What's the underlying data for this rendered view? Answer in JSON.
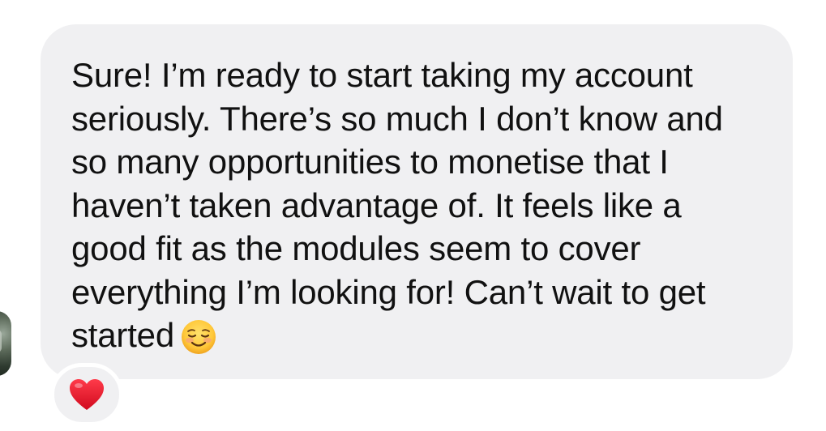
{
  "message": {
    "text": "Sure! I’m ready to start taking my account\nseriously. There’s so much I don’t know and\nso many opportunities to monetise that I\nhaven’t taken advantage of. It feels like a\ngood fit as the modules seem to cover\neverything I’m looking for! Can’t wait to get\nstarted",
    "trailing_emoji": "smiling-face-icon",
    "bubble_color": "#f0f0f2",
    "text_color": "#111111"
  },
  "reaction": {
    "icon": "red-heart-icon",
    "color": "#e8142a"
  },
  "sender": {
    "avatar": "avatar"
  }
}
